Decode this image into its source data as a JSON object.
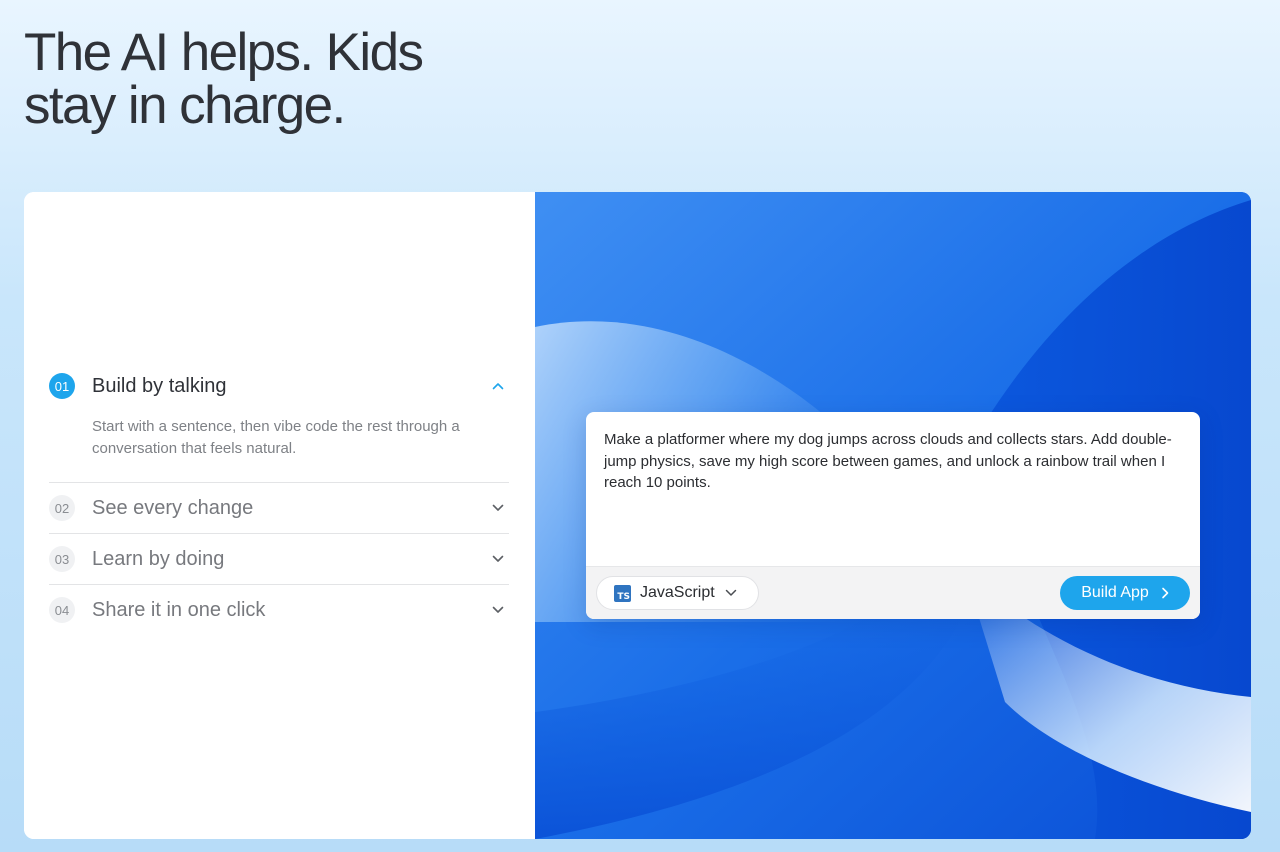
{
  "hero": {
    "line1": "The AI helps. Kids",
    "line2": "stay in charge."
  },
  "features": {
    "items": [
      {
        "num": "01",
        "title": "Build by talking",
        "description": "Start with a sentence, then vibe code the rest through a conversation that feels natural.",
        "open": true
      },
      {
        "num": "02",
        "title": "See every change",
        "open": false
      },
      {
        "num": "03",
        "title": "Learn by doing",
        "open": false
      },
      {
        "num": "04",
        "title": "Share it in one click",
        "open": false
      }
    ]
  },
  "prompt": {
    "text": "Make a platformer where my dog jumps across clouds and collects stars. Add double-jump physics, save my high score between games, and unlock a rainbow trail when I reach 10 points.",
    "language_label": "JavaScript",
    "language_icon_text": "TS",
    "build_label": "Build App"
  },
  "colors": {
    "accent": "#1ea5ec",
    "panel_blue": "#1366e6",
    "text_dark": "#2f3238",
    "text_muted": "#77797e"
  },
  "icons": {
    "open_chevron": "chevron-up-icon",
    "closed_chevron": "chevron-down-icon",
    "language": "typescript-icon",
    "button": "chevron-right-icon"
  }
}
